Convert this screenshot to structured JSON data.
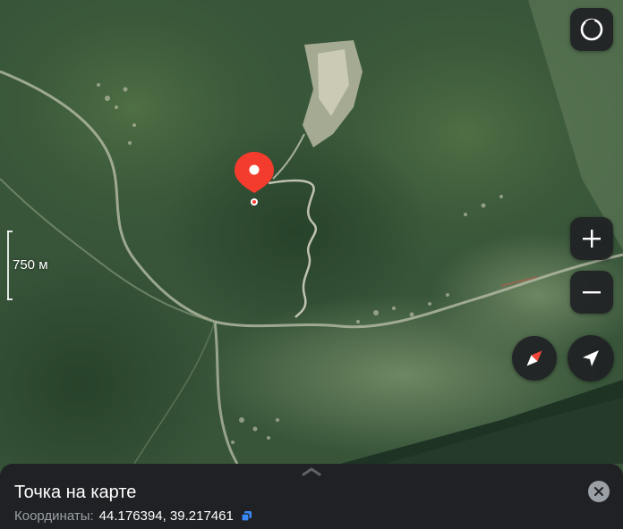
{
  "map": {
    "type": "satellite",
    "scale": {
      "label": "750 м"
    },
    "marker": {
      "color": "#f43c2e"
    },
    "controls": [
      {
        "name": "layers-button",
        "icon": "layers-ring-icon"
      },
      {
        "name": "zoom-in-button",
        "icon": "plus-icon"
      },
      {
        "name": "zoom-out-button",
        "icon": "minus-icon"
      },
      {
        "name": "compass-button",
        "icon": "compass-icon"
      },
      {
        "name": "locate-me-button",
        "icon": "location-arrow-icon"
      }
    ]
  },
  "info_sheet": {
    "title": "Точка на карте",
    "coordinates_label": "Координаты:",
    "coordinates_value": "44.176394, 39.217461",
    "copy_icon": "copy-icon",
    "close_icon": "close-icon",
    "accent_color": "#3a87f6"
  }
}
